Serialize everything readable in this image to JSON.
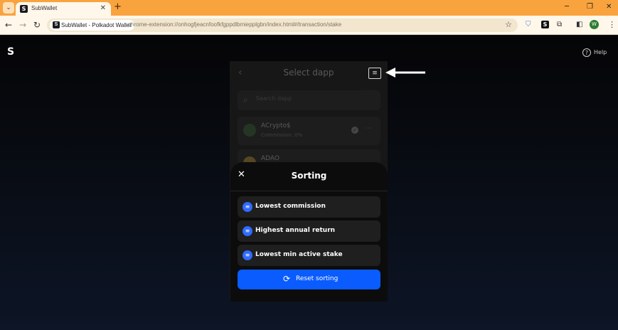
{
  "browser": {
    "tab_title": "SubWallet",
    "tab_favicon": "S",
    "tab_close": "✕",
    "new_tab": "+",
    "tab_dropdown": "⌄",
    "site_chip": "SubWallet - Polkadot Wallet",
    "url": "chrome-extension://onhogfjeacnfoofkfgppdlbmiepplgbn/index.html#/transaction/stake",
    "profile_initial": "W"
  },
  "app": {
    "logo": "S",
    "help_label": "Help"
  },
  "panel": {
    "title": "Select dapp",
    "search_placeholder": "Search dapp",
    "items": [
      {
        "name": "ACrypto$",
        "sub": "Commission: 0%"
      },
      {
        "name": "ADAO",
        "sub": ""
      }
    ]
  },
  "sheet": {
    "title": "Sorting",
    "options": [
      {
        "label": "Lowest commission"
      },
      {
        "label": "Highest annual return"
      },
      {
        "label": "Lowest min active stake"
      }
    ],
    "reset_label": "Reset sorting"
  },
  "colors": {
    "accent": "#0a5cff",
    "chrome_tab": "#f9a33e"
  }
}
